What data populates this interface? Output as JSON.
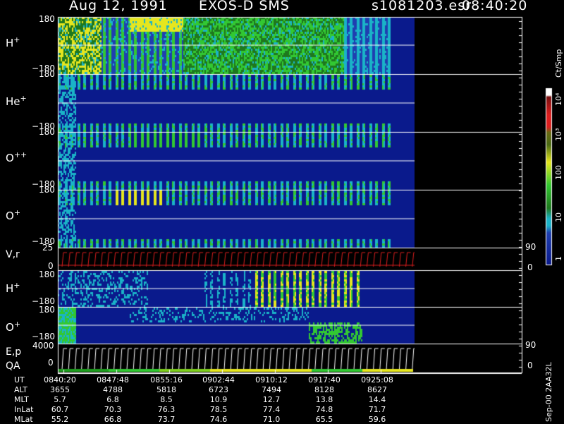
{
  "header": {
    "date": "Aug 12, 1991",
    "instrument": "EXOS-D SMS",
    "file": "s1081203.esr",
    "time": "08:40:20"
  },
  "panels": [
    {
      "label": "H",
      "charge": "+",
      "ticks": [
        "180",
        "−180"
      ]
    },
    {
      "label": "He",
      "charge": "+",
      "ticks": [
        "180",
        "−180"
      ]
    },
    {
      "label": "O",
      "charge": "++",
      "ticks": [
        "180",
        "−180"
      ]
    },
    {
      "label": "O",
      "charge": "+",
      "ticks": [
        "180",
        "−180"
      ]
    },
    {
      "label": "V,r",
      "charge": "",
      "ticks": [
        "25",
        "0"
      ],
      "right_ticks": [
        "90",
        "0"
      ]
    },
    {
      "label": "H",
      "charge": "+",
      "ticks": [
        "180",
        "−180"
      ]
    },
    {
      "label": "O",
      "charge": "+",
      "ticks": [
        "180",
        "−180"
      ]
    },
    {
      "label": "E,p",
      "label2": "QA",
      "ticks": [
        "4000",
        "0"
      ],
      "right_ticks": [
        "90",
        "0"
      ]
    }
  ],
  "colorbar": {
    "unit": "Ct/Smp",
    "tick_labels": [
      "10⁴",
      "10³",
      "100",
      "10",
      "1"
    ]
  },
  "orbit": {
    "labels": [
      "UT",
      "ALT",
      "MLT",
      "InLat",
      "MLat"
    ],
    "columns": [
      {
        "UT": "0840:20",
        "ALT": "3655",
        "MLT": "5.7",
        "InLat": "60.7",
        "MLat": "55.2"
      },
      {
        "UT": "0847:48",
        "ALT": "4788",
        "MLT": "6.8",
        "InLat": "70.3",
        "MLat": "66.8"
      },
      {
        "UT": "0855:16",
        "ALT": "5818",
        "MLT": "8.5",
        "InLat": "76.3",
        "MLat": "73.7"
      },
      {
        "UT": "0902:44",
        "ALT": "6723",
        "MLT": "10.9",
        "InLat": "78.5",
        "MLat": "74.6"
      },
      {
        "UT": "0910:12",
        "ALT": "7494",
        "MLT": "12.7",
        "InLat": "77.4",
        "MLat": "71.0"
      },
      {
        "UT": "0917:40",
        "ALT": "8128",
        "MLT": "13.8",
        "InLat": "74.8",
        "MLat": "65.5"
      },
      {
        "UT": "0925:08",
        "ALT": "8627",
        "MLT": "14.4",
        "InLat": "71.7",
        "MLat": "59.6"
      }
    ]
  },
  "footer": {
    "stamp": "Sep-00 2AA32L"
  },
  "colors": {
    "background": "#000000",
    "base_blue": "#0a1a8c",
    "cyan": "#1ab3c8",
    "green": "#32c832",
    "dark_green": "#1e781e",
    "yellow": "#e6e61e",
    "red": "#dc1e1e",
    "olive": "#6b6b14",
    "white": "#ffffff"
  },
  "chart_data": {
    "type": "heatmap",
    "title": "Aug 12, 1991   EXOS-D SMS",
    "x_ticks": [
      "0840:20",
      "0847:48",
      "0855:16",
      "0902:44",
      "0910:12",
      "0917:40",
      "0925:08"
    ],
    "colorscale": "log",
    "color_range": [
      1,
      10000
    ],
    "panel_y_ranges": [
      [
        -180,
        180
      ],
      [
        -180,
        180
      ],
      [
        -180,
        180
      ],
      [
        -180,
        180
      ],
      [
        0,
        25
      ],
      [
        -180,
        180
      ],
      [
        -180,
        180
      ],
      [
        0,
        4000
      ]
    ]
  }
}
